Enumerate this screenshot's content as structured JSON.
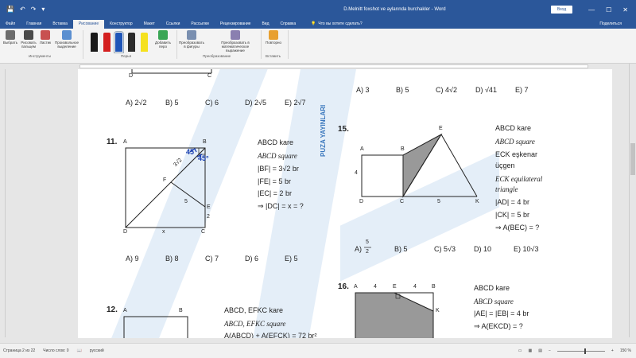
{
  "window": {
    "title": "D.Melnitt foxshot ve aylarında burchakler - Word",
    "login": "Вход",
    "share": "Поделиться",
    "tell_me": "Что вы хотите сделать?",
    "controls": {
      "min": "—",
      "max": "☐",
      "close": "✕"
    }
  },
  "qat": {
    "save": "💾",
    "undo": "↶",
    "redo": "↷",
    "more": "▾"
  },
  "tabs": [
    "Файл",
    "Главная",
    "Вставка",
    "Рисование",
    "Конструктор",
    "Макет",
    "Ссылки",
    "Рассылки",
    "Рецензирование",
    "Вид",
    "Справка"
  ],
  "active_tab": "Рисование",
  "ribbon": {
    "tools": [
      {
        "label": "Выбрать",
        "color": "#6b6b6b"
      },
      {
        "label": "Рисовать пальцем",
        "color": "#4a4a4a"
      },
      {
        "label": "Ластик",
        "color": "#c85050"
      },
      {
        "label": "Произвольное выделение",
        "color": "#5b8fd0"
      }
    ],
    "tools_group": "Инструменты",
    "pens_group": "Перья",
    "pens": [
      {
        "color": "#1a1a1a",
        "tip": "#1a1a1a"
      },
      {
        "color": "#d42020",
        "tip": "#d42020"
      },
      {
        "color": "#1e55b8",
        "tip": "#1e55b8",
        "selected": true
      },
      {
        "color": "#2c2c2c",
        "tip": "#5a5a5a"
      },
      {
        "color": "#f5e11e",
        "tip": "#f5e11e"
      }
    ],
    "add_pen": "Добавить перо",
    "convert_shape": "Преобразовать в фигуры",
    "convert_math": "Преобразовать в математическое выражение",
    "convert_group": "Преобразование",
    "replay": "Повторно",
    "insert_group": "Вставить"
  },
  "doc": {
    "q10_answers": [
      "A) 2√2",
      "B) 5",
      "C) 6",
      "D) 2√5",
      "E) 2√7"
    ],
    "q10_labels": [
      "D",
      "C"
    ],
    "q11": {
      "number": "11.",
      "labels": {
        "A": "A",
        "B": "B",
        "C": "C",
        "D": "D",
        "E": "E",
        "F": "F"
      },
      "side_labels": {
        "bf": "3√2",
        "fe": "5",
        "ec": "2",
        "dc": "x"
      },
      "handwriting": [
        "45",
        "45°"
      ],
      "text": [
        "ABCD kare",
        "ABCD square",
        "|BF| = 3√2 br",
        "|FE| = 5 br",
        "|EC| = 2 br",
        "⇒ |DC| = x = ?"
      ],
      "answers": [
        "A) 9",
        "B) 8",
        "C) 7",
        "D) 6",
        "E) 5"
      ]
    },
    "q14_answers": [
      "A) 3",
      "B) 5",
      "C) 4√2",
      "D) √41",
      "E) 7"
    ],
    "publisher": "PUZA YAYINLARI",
    "q15": {
      "number": "15.",
      "labels": {
        "A": "A",
        "B": "B",
        "C": "C",
        "D": "D",
        "E": "E",
        "K": "K"
      },
      "side_labels": {
        "ad": "4",
        "ck": "5"
      },
      "text": [
        "ABCD kare",
        "ABCD square",
        "ECK eşkenar",
        "üçgen",
        "ECK  equilateral",
        "triangle",
        "|AD| = 4 br",
        "|CK| = 5 br",
        "⇒ A(BEC) = ?"
      ],
      "answers": [
        "A)",
        "B) 5",
        "C) 5√3",
        "D) 10",
        "E) 10√3"
      ],
      "frac": {
        "num": "5",
        "den": "2"
      }
    },
    "q16": {
      "number": "16.",
      "top_labels": [
        "A",
        "4",
        "E",
        "4",
        "B"
      ],
      "label_k": "K",
      "text": [
        "ABCD kare",
        "ABCD square",
        "|AE| = |EB| = 4 br",
        "⇒ A(EKCD) = ?"
      ]
    },
    "q12": {
      "number": "12.",
      "labels": [
        "A",
        "B"
      ],
      "text": [
        "ABCD, EFKC kare",
        "ABCD, EFKC square",
        "A(ABCD) + A(EFCK) = 72 br²"
      ]
    }
  },
  "status": {
    "page": "Страница 2 из 22",
    "words": "Число слов: 0",
    "lang": "русский",
    "zoom": "150 %"
  }
}
